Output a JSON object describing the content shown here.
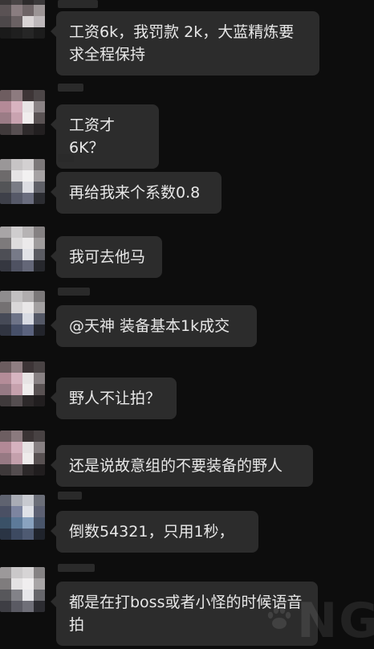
{
  "watermark": "NGA",
  "messages": [
    {
      "text": "工资6k，我罚款 2k，大蓝精炼要求全程保持"
    },
    {
      "text": "工资才6K？"
    },
    {
      "text": "再给我来个系数0.8"
    },
    {
      "text": "我可去他马"
    },
    {
      "text": "@天神 装备基本1k成交"
    },
    {
      "text": "野人不让拍？"
    },
    {
      "text": "还是说故意组的不要装备的野人"
    },
    {
      "text": "倒数54321，只用1秒，"
    },
    {
      "text": "都是在打boss或者小怪的时候语音拍"
    }
  ]
}
